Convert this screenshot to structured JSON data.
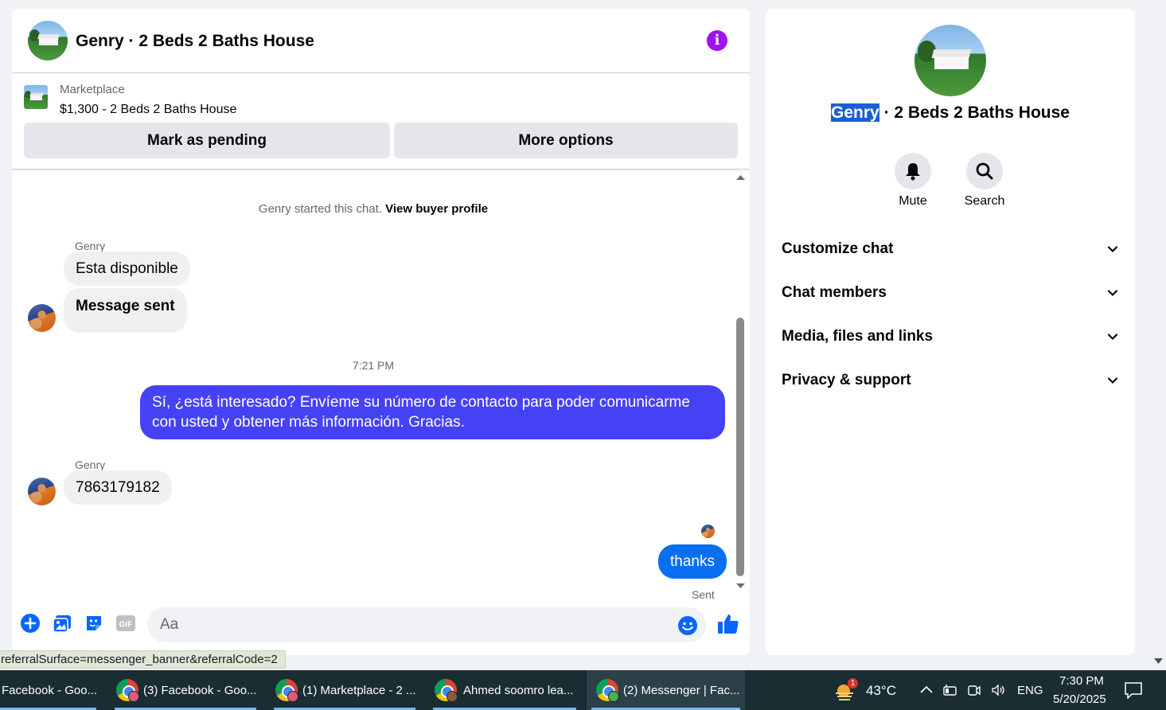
{
  "chat": {
    "header_title": "Genry · 2 Beds 2 Baths House",
    "listing": {
      "source": "Marketplace",
      "title": "$1,300 - 2 Beds 2 Baths House",
      "mark_pending_label": "Mark as pending",
      "more_options_label": "More options"
    },
    "system_note": "Genry started this chat.",
    "system_link": "View buyer profile",
    "messages": [
      {
        "sender": "Genry",
        "text": "Esta disponible"
      },
      {
        "text": "Message sent"
      },
      {
        "time": "7:21 PM"
      },
      {
        "text": "Sí, ¿está interesado? Envíeme su número de contacto para poder comunicarme con usted y obtener más información. Gracias."
      },
      {
        "sender": "Genry",
        "text": "7863179182"
      },
      {
        "text": "thanks",
        "status": "Sent"
      }
    ],
    "input_placeholder": "Aa"
  },
  "details": {
    "name_highlight": "Genry",
    "name_rest": " · 2 Beds 2 Baths House",
    "mute_label": "Mute",
    "search_label": "Search",
    "sections": [
      "Customize chat",
      "Chat members",
      "Media, files and links",
      "Privacy & support"
    ]
  },
  "status_url": "referralSurface=messenger_banner&referralCode=2",
  "taskbar": {
    "tasks": [
      "Facebook - Goo...",
      "(3) Facebook - Goo...",
      "(1) Marketplace - 2 ...",
      "Ahmed soomro lea...",
      "(2) Messenger | Fac..."
    ],
    "weather_badge": "1",
    "temperature": "43°C",
    "language": "ENG",
    "time": "7:30 PM",
    "date": "5/20/2025"
  },
  "colors": {
    "outgoing_bubble": "#4542f5",
    "outgoing_bubble_last": "#0a6ef0",
    "accent": "#0866ff",
    "info_icon": "#a012f0"
  }
}
